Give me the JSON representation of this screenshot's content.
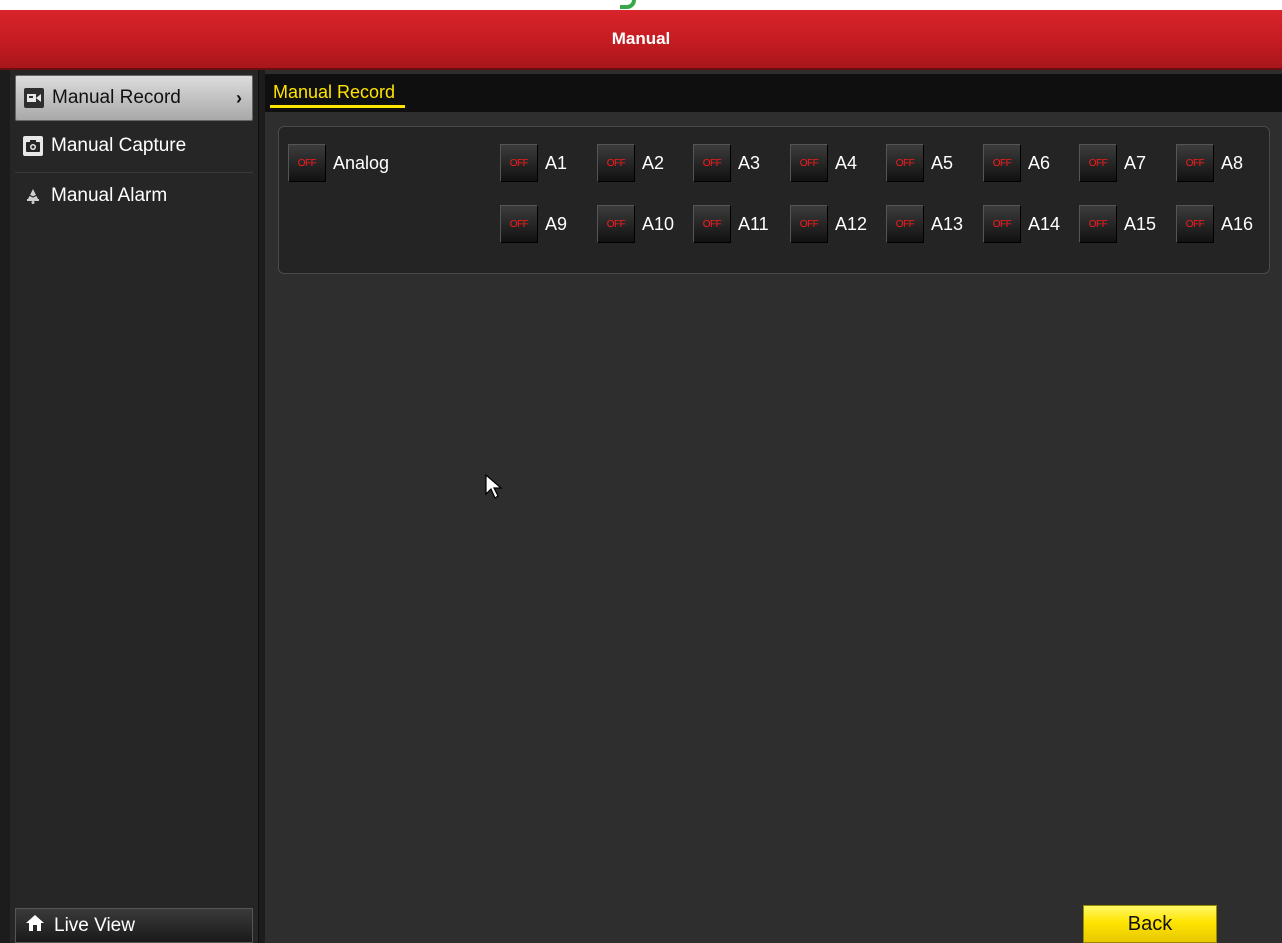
{
  "window": {
    "title": "Manual"
  },
  "sidebar": {
    "items": [
      {
        "label": "Manual Record",
        "icon": "video-camera-icon",
        "active": true
      },
      {
        "label": "Manual Capture",
        "icon": "camera-icon",
        "active": false
      },
      {
        "label": "Manual Alarm",
        "icon": "alarm-bell-icon",
        "active": false
      }
    ],
    "live_view": {
      "label": "Live View",
      "icon": "home-icon"
    }
  },
  "main": {
    "tab": "Manual Record",
    "analog": {
      "label": "Analog",
      "state": "OFF"
    },
    "channels": [
      {
        "label": "A1",
        "state": "OFF"
      },
      {
        "label": "A2",
        "state": "OFF"
      },
      {
        "label": "A3",
        "state": "OFF"
      },
      {
        "label": "A4",
        "state": "OFF"
      },
      {
        "label": "A5",
        "state": "OFF"
      },
      {
        "label": "A6",
        "state": "OFF"
      },
      {
        "label": "A7",
        "state": "OFF"
      },
      {
        "label": "A8",
        "state": "OFF"
      },
      {
        "label": "A9",
        "state": "OFF"
      },
      {
        "label": "A10",
        "state": "OFF"
      },
      {
        "label": "A11",
        "state": "OFF"
      },
      {
        "label": "A12",
        "state": "OFF"
      },
      {
        "label": "A13",
        "state": "OFF"
      },
      {
        "label": "A14",
        "state": "OFF"
      },
      {
        "label": "A15",
        "state": "OFF"
      },
      {
        "label": "A16",
        "state": "OFF"
      }
    ],
    "back_label": "Back"
  },
  "colors": {
    "title_bar": "#c41c22",
    "tab_accent": "#ffe400",
    "off_text": "#ff1a1a",
    "back_button": "#ffe400"
  }
}
